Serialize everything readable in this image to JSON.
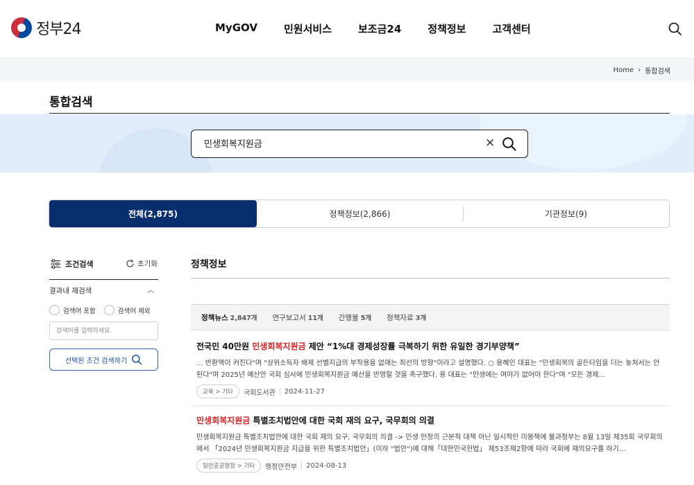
{
  "header": {
    "logo_text": "정부24",
    "nav": [
      "MyGOV",
      "민원서비스",
      "보조금24",
      "정책정보",
      "고객센터"
    ]
  },
  "breadcrumb": {
    "home": "Home",
    "current": "통합검색"
  },
  "page": {
    "title": "통합검색"
  },
  "search": {
    "value": "민생회복지원금",
    "clear": "×"
  },
  "tabs": [
    {
      "label": "전체(2,875)",
      "active": true
    },
    {
      "label": "정책정보(2,866)",
      "active": false
    },
    {
      "label": "기관정보(9)",
      "active": false
    }
  ],
  "filter": {
    "title": "조건검색",
    "reset": "초기화",
    "refine_title": "결과내 재검색",
    "include": "검색어 포함",
    "exclude": "검색어 제외",
    "placeholder": "검색어를 입력하세요.",
    "apply": "선택된 조건 검색하기"
  },
  "section": {
    "title": "정책정보",
    "subtabs": [
      {
        "label": "정책뉴스",
        "count": "2,847개",
        "active": true
      },
      {
        "label": "연구보고서",
        "count": "11개",
        "active": false
      },
      {
        "label": "간행물",
        "count": "5개",
        "active": false
      },
      {
        "label": "정책자료",
        "count": "3개",
        "active": false
      }
    ]
  },
  "results": [
    {
      "title_pre": "전국민 40만원 ",
      "title_hl": "민생회복지원금",
      "title_post": " 제안 “1%대 경제성장률 극복하기 위한 유일한 경기부양책”",
      "body": "... 반환액이 커진다\"며 \"상위소득자 배제 선별지급의 부작용을 없애는 최선의 방향\"이라고 설명했다. ○ 용혜인 대표는 \"민생회복의 골든타임을 더는 놓쳐서는 안된다\"며 2025년 예산안 국회 심사에 민생회복지원금 예산을 반영할 것을 촉구했다. 용 대표는 \"민생에는 여야가 없어야 한다\"며 \"모든 경제...",
      "category": "교육 > 기타",
      "agency": "국회도서관",
      "date": "2024-11-27"
    },
    {
      "title_pre": "",
      "title_hl": "민생회복지원금",
      "title_post": " 특별조치법안에 대한 국회 재의 요구, 국무회의 의결",
      "body": "민생회복지원금 특별조치법안에 대한 국회 재의 요구, 국무회의 의결 -> 민생 안정의 근본적 대책 아닌 일시적인 미봉책에 불과정부는 8월 13일 제35회 국무회의에서 「2024년 민생회복지원금 지급을 위한 특별조치법안」(이하 \"법안\")에 대해「대한민국헌법」 제53조제2항에 따라 국회에 재의요구를 하기...",
      "category": "일반공공행정 > 기타",
      "agency": "행정안전부",
      "date": "2024-08-13"
    }
  ]
}
